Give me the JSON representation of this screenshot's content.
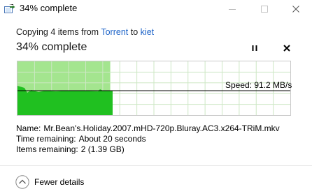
{
  "window": {
    "title": "34% complete"
  },
  "header": {
    "copy_prefix": "Copying 4 items from",
    "source": "Torrent",
    "to_word": "to",
    "destination": "kiet",
    "progress_title": "34% complete",
    "progress_percent": 34
  },
  "speed": {
    "label": "Speed: 91.2 MB/s"
  },
  "details": {
    "name_label": "Name:",
    "name_value": "Mr.Bean's.Holiday.2007.mHD-720p.Bluray.AC3.x264-TRiM.mkv",
    "time_label": "Time remaining:",
    "time_value": "About 20 seconds",
    "items_label": "Items remaining:",
    "items_value": "2 (1.39 GB)"
  },
  "footer": {
    "toggle_label": "Fewer details"
  },
  "colors": {
    "accent_link": "#1e64c8",
    "progress_fill": "#a4e58f",
    "speed_fill": "#20c020",
    "grid": "#cde7c4"
  }
}
